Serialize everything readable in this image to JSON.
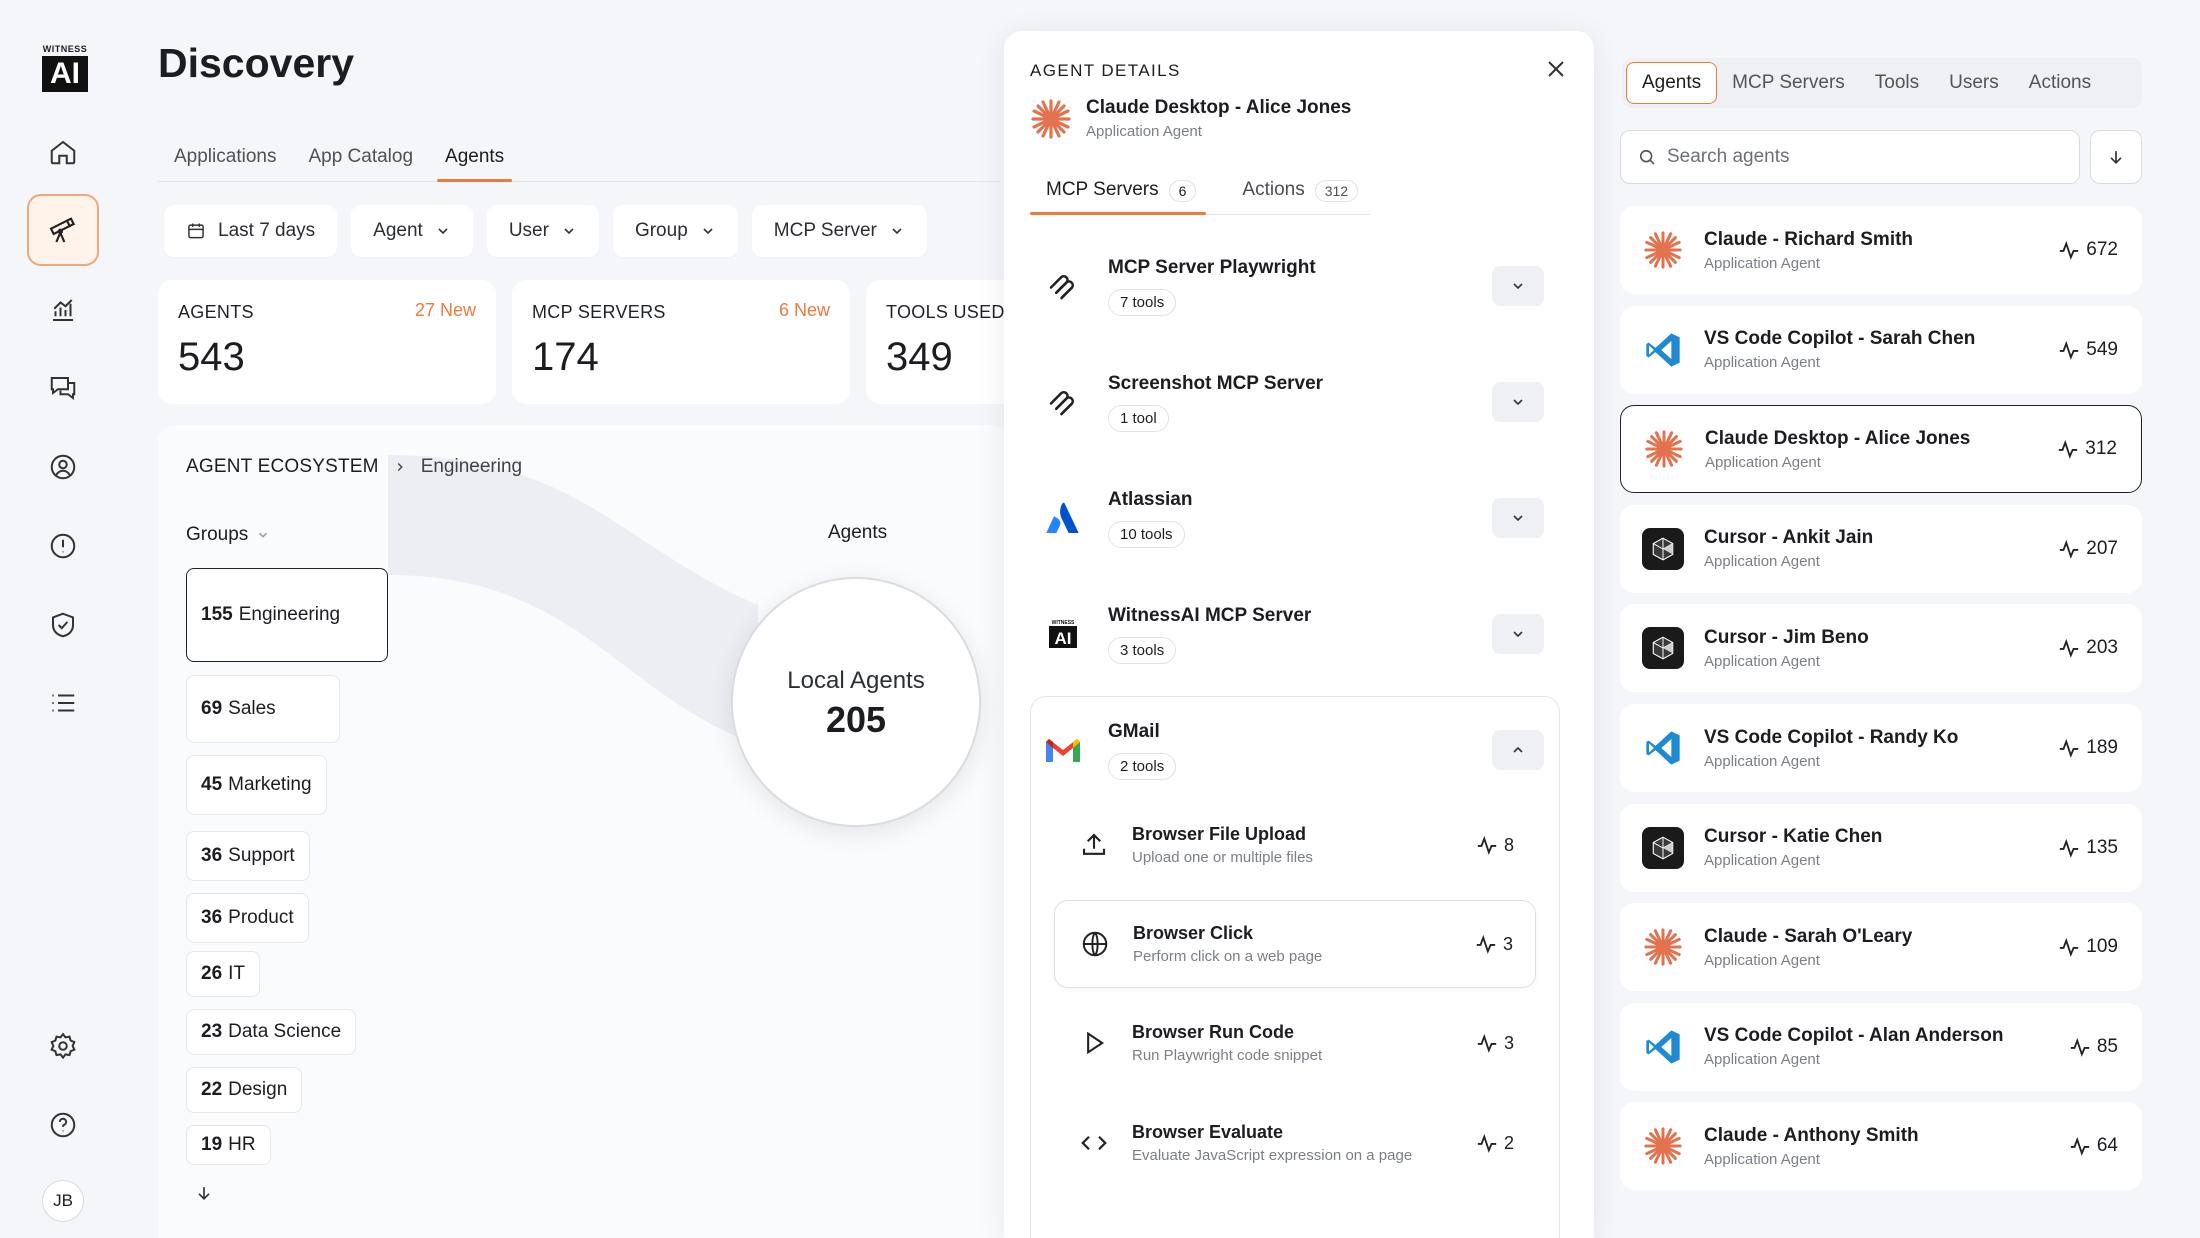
{
  "brand": {
    "line1": "WITNESS",
    "line2": "AI"
  },
  "user_initials": "JB",
  "page": {
    "title": "Discovery"
  },
  "nav_tabs": [
    {
      "label": "Applications",
      "active": false
    },
    {
      "label": "App Catalog",
      "active": false
    },
    {
      "label": "Agents",
      "active": true
    }
  ],
  "filters": [
    "Last 7 days",
    "Agent",
    "User",
    "Group",
    "MCP Server"
  ],
  "stats": [
    {
      "label": "AGENTS",
      "value": "543",
      "badge": "27 New"
    },
    {
      "label": "MCP SERVERS",
      "value": "174",
      "badge": "6 New"
    },
    {
      "label": "TOOLS USED",
      "value": "349",
      "badge": ""
    }
  ],
  "ecosystem": {
    "crumb_root": "AGENT ECOSYSTEM",
    "crumb_child": "Engineering",
    "groups_label": "Groups",
    "agents_label": "Agents",
    "groups": [
      {
        "count": "155",
        "name": "Engineering"
      },
      {
        "count": "69",
        "name": "Sales"
      },
      {
        "count": "45",
        "name": "Marketing"
      },
      {
        "count": "36",
        "name": "Support"
      },
      {
        "count": "36",
        "name": "Product"
      },
      {
        "count": "26",
        "name": "IT"
      },
      {
        "count": "23",
        "name": "Data Science"
      },
      {
        "count": "22",
        "name": "Design"
      },
      {
        "count": "19",
        "name": "HR"
      }
    ],
    "bubble": {
      "label": "Local Agents",
      "value": "205"
    }
  },
  "details": {
    "heading": "AGENT DETAILS",
    "agent_name": "Claude Desktop - Alice Jones",
    "agent_type": "Application Agent",
    "tabs": [
      {
        "label": "MCP Servers",
        "count": "6"
      },
      {
        "label": "Actions",
        "count": "312"
      }
    ],
    "servers": [
      {
        "name": "MCP Server Playwright",
        "tools": "7 tools",
        "icon": "playwright-icon"
      },
      {
        "name": "Screenshot MCP Server",
        "tools": "1 tool",
        "icon": "playwright-icon"
      },
      {
        "name": "Atlassian",
        "tools": "10 tools",
        "icon": "atlassian-icon"
      },
      {
        "name": "WitnessAI MCP Server",
        "tools": "3 tools",
        "icon": "witnessai-icon"
      },
      {
        "name": "GMail",
        "tools": "2 tools",
        "icon": "gmail-icon"
      }
    ],
    "tools": [
      {
        "name": "Browser File Upload",
        "desc": "Upload one or multiple files",
        "count": "8",
        "icon": "upload-icon"
      },
      {
        "name": "Browser Click",
        "desc": "Perform click on a web page",
        "count": "3",
        "icon": "globe-icon"
      },
      {
        "name": "Browser Run Code",
        "desc": "Run Playwright code snippet",
        "count": "3",
        "icon": "play-icon"
      },
      {
        "name": "Browser Evaluate",
        "desc": "Evaluate JavaScript expression on a page",
        "count": "2",
        "icon": "code-icon"
      }
    ]
  },
  "right": {
    "tabs": [
      "Agents",
      "MCP Servers",
      "Tools",
      "Users",
      "Actions"
    ],
    "search_placeholder": "Search agents",
    "agents": [
      {
        "name": "Claude - Richard Smith",
        "type": "Application Agent",
        "count": "672",
        "icon": "claude-icon"
      },
      {
        "name": "VS Code Copilot - Sarah Chen",
        "type": "Application Agent",
        "count": "549",
        "icon": "vscode-icon"
      },
      {
        "name": "Claude Desktop - Alice Jones",
        "type": "Application Agent",
        "count": "312",
        "icon": "claude-icon"
      },
      {
        "name": "Cursor - Ankit Jain",
        "type": "Application Agent",
        "count": "207",
        "icon": "cursor-icon"
      },
      {
        "name": "Cursor - Jim Beno",
        "type": "Application Agent",
        "count": "203",
        "icon": "cursor-icon"
      },
      {
        "name": "VS Code Copilot - Randy Ko",
        "type": "Application Agent",
        "count": "189",
        "icon": "vscode-icon"
      },
      {
        "name": "Cursor - Katie Chen",
        "type": "Application Agent",
        "count": "135",
        "icon": "cursor-icon"
      },
      {
        "name": "Claude - Sarah O'Leary",
        "type": "Application Agent",
        "count": "109",
        "icon": "claude-icon"
      },
      {
        "name": "VS Code Copilot - Alan Anderson",
        "type": "Application Agent",
        "count": "85",
        "icon": "vscode-icon"
      },
      {
        "name": "Claude - Anthony Smith",
        "type": "Application Agent",
        "count": "64",
        "icon": "claude-icon"
      }
    ]
  },
  "colors": {
    "accent": "#ee7a3c",
    "claude": "#e2734e",
    "vscode": "#1f8ad2"
  }
}
